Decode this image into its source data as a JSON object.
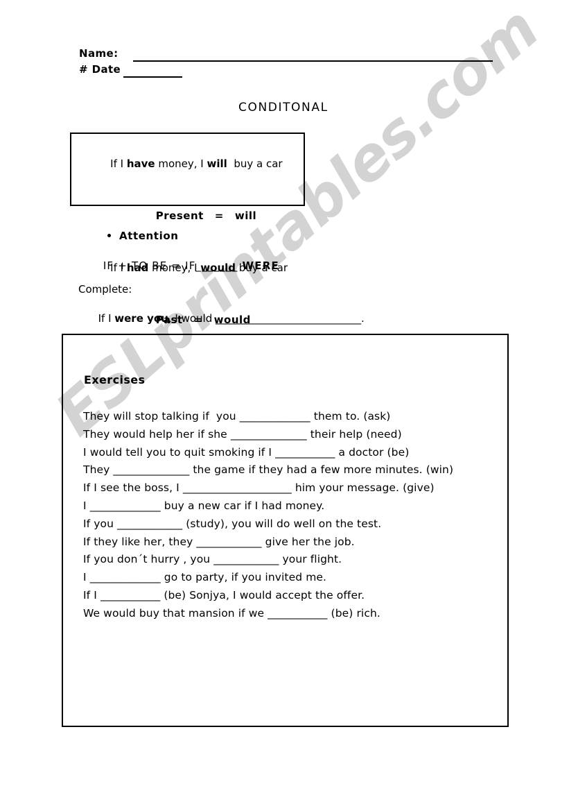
{
  "header": {
    "name_label": "Name:",
    "date_label": "# Date",
    "date_blank": "________"
  },
  "title": "CONDITONAL",
  "rule_box": {
    "line1": "If I have money, I will  buy a car",
    "line1_parts": {
      "pre": "If I ",
      "bold1": "have",
      "mid": " money, I ",
      "bold2": "will",
      "post": "  buy a car"
    },
    "line2_left": "Present",
    "line2_eq": "=",
    "line2_right": "will",
    "line3_parts": {
      "pre": "If I ",
      "bold1": "had",
      "mid": " money, I ",
      "bold2": "would",
      "post": " buy a car"
    },
    "line4_left": "Past",
    "line4_eq": "=",
    "line4_right": "would"
  },
  "attention": {
    "heading": "Attention",
    "formula_pre": "IF + TO BE = IF",
    "formula_blank": "_______",
    "formula_bold": "WERE"
  },
  "complete": {
    "label": "Complete:",
    "sentence_pre": "If I ",
    "sentence_bold": "were you",
    "sentence_mid": ", I would ",
    "sentence_blank": "____________________________",
    "sentence_end": "."
  },
  "exercises": {
    "title": "Exercises",
    "items": [
      "They will stop talking if  you _____________ them to. (ask)",
      "They would help her if she ______________ their help (need)",
      "I would tell you to quit smoking if I ___________ a doctor (be)",
      "They ______________ the game if they had a few more minutes. (win)",
      "If I see the boss, I ____________________ him your message. (give)",
      "I _____________ buy a new car if I had money.",
      "If you ____________ (study), you will do well on the test.",
      "If they like her, they ____________ give her the job.",
      "If you don´t hurry , you ____________ your flight.",
      "I _____________ go to party, if you invited me.",
      "If I ___________ (be) Sonjya, I would accept the offer.",
      "We would buy that mansion if we ___________ (be) rich."
    ]
  },
  "watermark": {
    "text": "ESLprintables.com",
    "color": "#d3d3d3"
  }
}
